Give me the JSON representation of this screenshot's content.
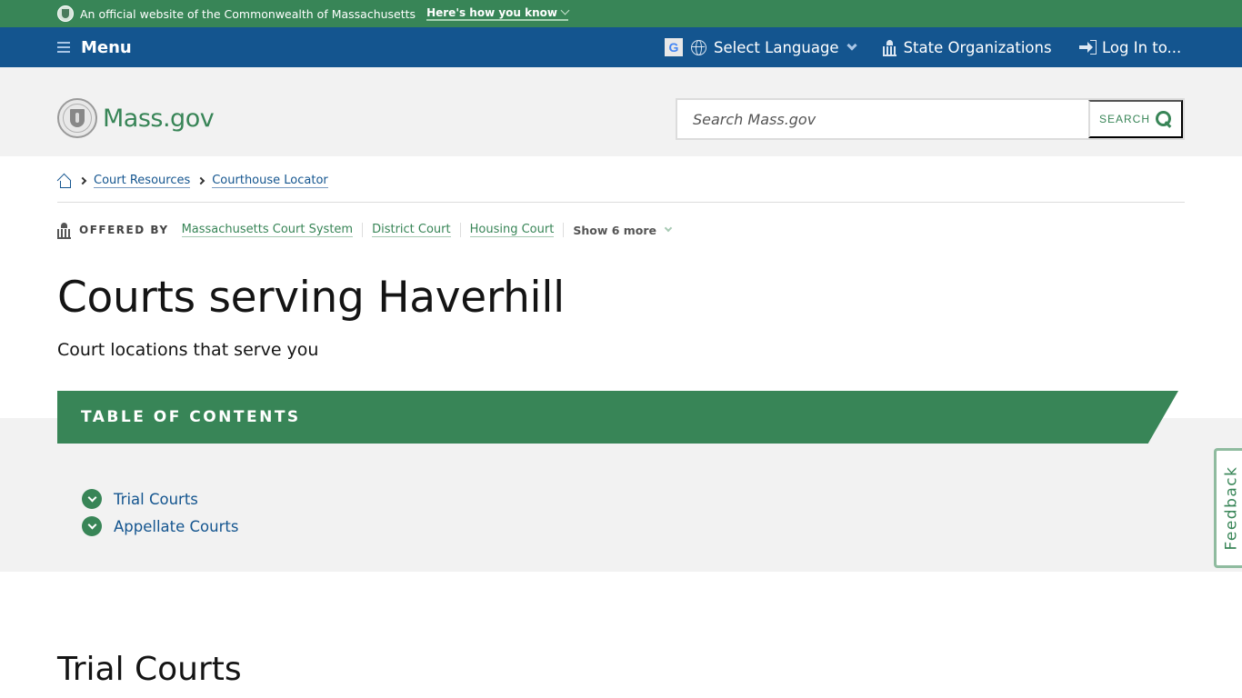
{
  "official_banner": {
    "text": "An official website of the Commonwealth of Massachusetts",
    "how_link": "Here's how you know"
  },
  "nav": {
    "menu_label": "Menu",
    "language_label": "Select Language",
    "state_orgs_label": "State Organizations",
    "login_label": "Log In to..."
  },
  "header": {
    "logo_text": "Mass.gov",
    "search_placeholder": "Search Mass.gov",
    "search_button": "SEARCH"
  },
  "breadcrumb": {
    "items": [
      "Court Resources",
      "Courthouse Locator"
    ]
  },
  "offered_by": {
    "label": "OFFERED BY",
    "orgs": [
      "Massachusetts Court System",
      "District Court",
      "Housing Court"
    ],
    "show_more": "Show 6 more"
  },
  "page": {
    "title": "Courts serving Haverhill",
    "subtitle": "Court locations that serve you"
  },
  "toc": {
    "heading": "TABLE OF CONTENTS",
    "items": [
      "Trial Courts",
      "Appellate Courts"
    ]
  },
  "feedback_label": "Feedback",
  "section": {
    "title": "Trial Courts"
  },
  "colors": {
    "brand_green": "#388557",
    "nav_blue": "#14558f",
    "header_gray": "#f2f2f2"
  }
}
